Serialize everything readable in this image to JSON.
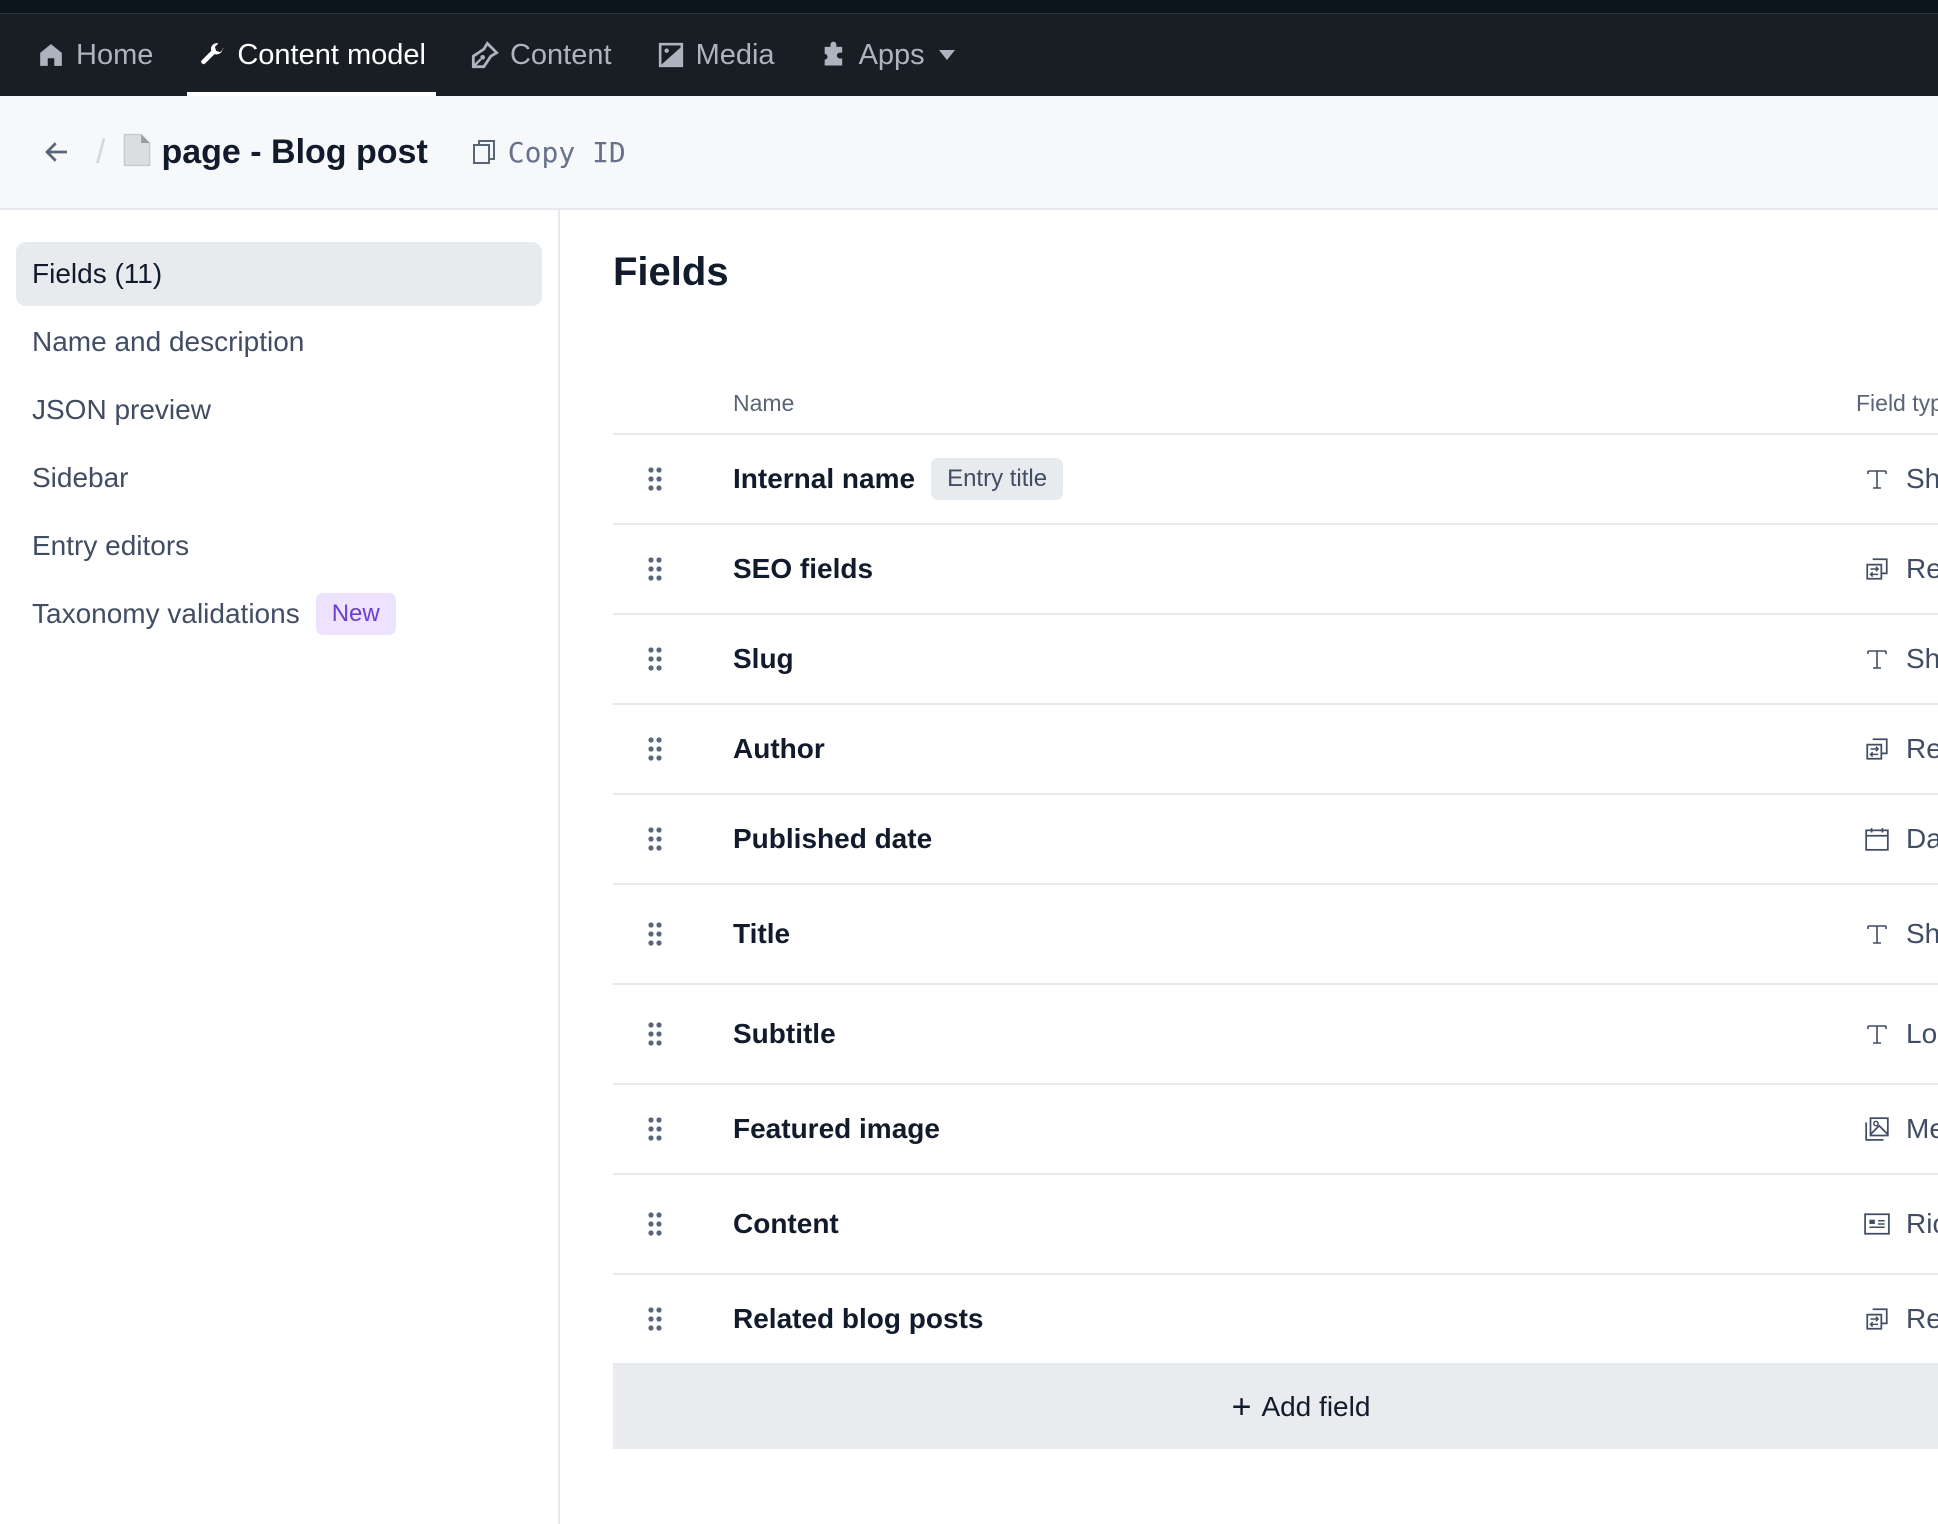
{
  "nav": {
    "items": [
      {
        "label": "Home",
        "icon": "home-icon",
        "active": false
      },
      {
        "label": "Content model",
        "icon": "wrench-icon",
        "active": true
      },
      {
        "label": "Content",
        "icon": "pen-nib-icon",
        "active": false
      },
      {
        "label": "Media",
        "icon": "image-icon",
        "active": false
      },
      {
        "label": "Apps",
        "icon": "puzzle-icon",
        "active": false,
        "dropdown": true
      }
    ]
  },
  "breadcrumb": {
    "back_icon": "arrow-left-icon",
    "separator": "/",
    "doc_icon": "document-icon",
    "title": "page - Blog post",
    "copy_id_label": "Copy ID",
    "copy_icon": "copy-icon"
  },
  "sidebar": {
    "items": [
      {
        "label": "Fields (11)",
        "active": true
      },
      {
        "label": "Name and description",
        "active": false
      },
      {
        "label": "JSON preview",
        "active": false
      },
      {
        "label": "Sidebar",
        "active": false
      },
      {
        "label": "Entry editors",
        "active": false
      },
      {
        "label": "Taxonomy validations",
        "active": false,
        "badge": "New"
      }
    ]
  },
  "main": {
    "heading": "Fields",
    "columns": {
      "name": "Name",
      "field_type": "Field type"
    },
    "fields": [
      {
        "name": "Internal name",
        "badge": "Entry title",
        "type_icon": "text-icon",
        "type_label": "Short text"
      },
      {
        "name": "SEO fields",
        "type_icon": "reference-icon",
        "type_label": "Reference"
      },
      {
        "name": "Slug",
        "type_icon": "text-icon",
        "type_label": "Short text"
      },
      {
        "name": "Author",
        "type_icon": "reference-icon",
        "type_label": "Reference"
      },
      {
        "name": "Published date",
        "type_icon": "calendar-icon",
        "type_label": "Date & time"
      },
      {
        "name": "Title",
        "type_icon": "text-icon",
        "type_label": "Short text"
      },
      {
        "name": "Subtitle",
        "type_icon": "text-icon",
        "type_label": "Long text"
      },
      {
        "name": "Featured image",
        "type_icon": "media-icon",
        "type_label": "Media"
      },
      {
        "name": "Content",
        "type_icon": "rich-text-icon",
        "type_label": "Rich text"
      },
      {
        "name": "Related blog posts",
        "type_icon": "reference-icon",
        "type_label": "References"
      }
    ],
    "add_field_label": "Add field"
  },
  "colors": {
    "nav_bg": "#191d24",
    "nav_text": "#aeb4bf",
    "accent_badge_bg": "#ede3ff",
    "accent_badge_text": "#6c3ecf"
  }
}
